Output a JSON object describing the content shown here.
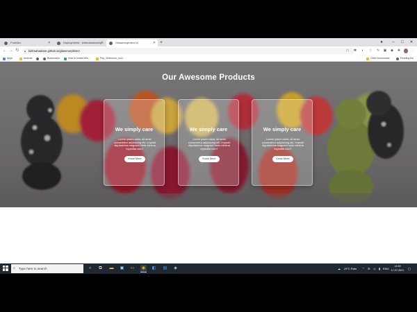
{
  "tabs": [
    {
      "title": "Portfolio",
      "active": false
    },
    {
      "title": "Deployments · kiritmahadane/g…",
      "active": false
    },
    {
      "title": "Glassmorphism UI",
      "active": true
    }
  ],
  "new_tab": "+",
  "window_controls": {
    "minimize": "–",
    "maximize": "□",
    "close": "✕"
  },
  "address": {
    "url": "kiritmahadane.github.io/glassmorphism/"
  },
  "bookmarks": [
    {
      "label": "Apps"
    },
    {
      "label": "Android"
    },
    {
      "label": ""
    },
    {
      "label": "Bookmarks"
    },
    {
      "label": "How to Install Win…"
    },
    {
      "label": "Pay_VideoIcos_Icon…"
    }
  ],
  "bookmarks_right": [
    {
      "label": "Other bookmarks"
    },
    {
      "label": "Reading list"
    }
  ],
  "page": {
    "title": "Our Awesome Products",
    "cards": [
      {
        "title": "We simply care",
        "text": "Lorem ipsum dolor, sit amet consectetur adipisicing elit. Impedit dignissimos magnam iusto minima expedita cum?",
        "button": "Know More"
      },
      {
        "title": "We simply care",
        "text": "Lorem ipsum dolor, sit amet consectetur adipisicing elit. Impedit dignissimos magnam iusto minima expedita cum?",
        "button": "Know More"
      },
      {
        "title": "We simply care",
        "text": "Lorem ipsum dolor, sit amet consectetur adipisicing elit. Impedit dignissimos magnam iusto minima expedita cum?",
        "button": "Know More"
      }
    ]
  },
  "taskbar": {
    "search_placeholder": "Type here to search",
    "weather": "29°C  Rain",
    "language": "ENG",
    "time": "14:59",
    "date": "17-07-2021"
  },
  "colors": {
    "tabstrip": "#dfe1e5",
    "taskbar": "#1f2830",
    "card_border": "#ffffff"
  }
}
